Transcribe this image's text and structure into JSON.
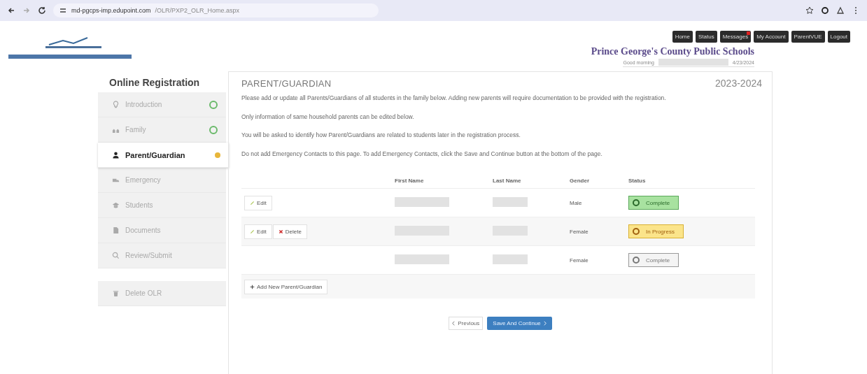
{
  "browser": {
    "url_host": "md-pgcps-imp.edupoint.com",
    "url_path": "/OLR/PXP2_OLR_Home.aspx"
  },
  "nav": [
    {
      "label": "Home",
      "badge": false
    },
    {
      "label": "Status",
      "badge": false
    },
    {
      "label": "Messages",
      "badge": true
    },
    {
      "label": "My Account",
      "badge": false
    },
    {
      "label": "ParentVUE",
      "badge": false
    },
    {
      "label": "Logout",
      "badge": false
    }
  ],
  "header": {
    "org": "Prince George's County Public Schools",
    "greeting": "Good morning",
    "date": "4/23/2024"
  },
  "sidebar": {
    "title": "Online Registration",
    "items": [
      {
        "label": "Introduction",
        "done": true,
        "attention": false,
        "selected": false
      },
      {
        "label": "Family",
        "done": true,
        "attention": false,
        "selected": false
      },
      {
        "label": "Parent/Guardian",
        "done": false,
        "attention": true,
        "selected": true
      },
      {
        "label": "Emergency",
        "done": false,
        "attention": false,
        "selected": false
      },
      {
        "label": "Students",
        "done": false,
        "attention": false,
        "selected": false
      },
      {
        "label": "Documents",
        "done": false,
        "attention": false,
        "selected": false
      },
      {
        "label": "Review/Submit",
        "done": false,
        "attention": false,
        "selected": false
      }
    ],
    "delete_label": "Delete OLR"
  },
  "main": {
    "title": "PARENT/GUARDIAN",
    "year": "2023-2024",
    "paragraphs": [
      "Please add or update all Parents/Guardians of all students in the family below. Adding new parents will require documentation to be provided with the registration.",
      "Only information of same household parents can be edited below.",
      "You will be asked to identify how Parent/Guardians are related to students later in the registration process.",
      "Do not add Emergency Contacts to this page. To add Emergency Contacts, click the Save and Continue button at the bottom of the page."
    ]
  },
  "table": {
    "columns": [
      "First Name",
      "Last Name",
      "Gender",
      "Status"
    ],
    "rows": [
      {
        "actions": [
          {
            "label": "Edit",
            "kind": "edit"
          }
        ],
        "gender": "Male",
        "status": {
          "label": "Complete",
          "kind": "complete"
        }
      },
      {
        "actions": [
          {
            "label": "Edit",
            "kind": "edit"
          },
          {
            "label": "Delete",
            "kind": "delete"
          }
        ],
        "gender": "Female",
        "status": {
          "label": "In Progress",
          "kind": "in_progress"
        }
      },
      {
        "actions": [],
        "gender": "Female",
        "status": {
          "label": "Complete",
          "kind": "locked"
        }
      }
    ],
    "add_label": "Add New Parent/Guardian"
  },
  "footer": {
    "previous": "Previous",
    "save": "Save And Continue"
  }
}
